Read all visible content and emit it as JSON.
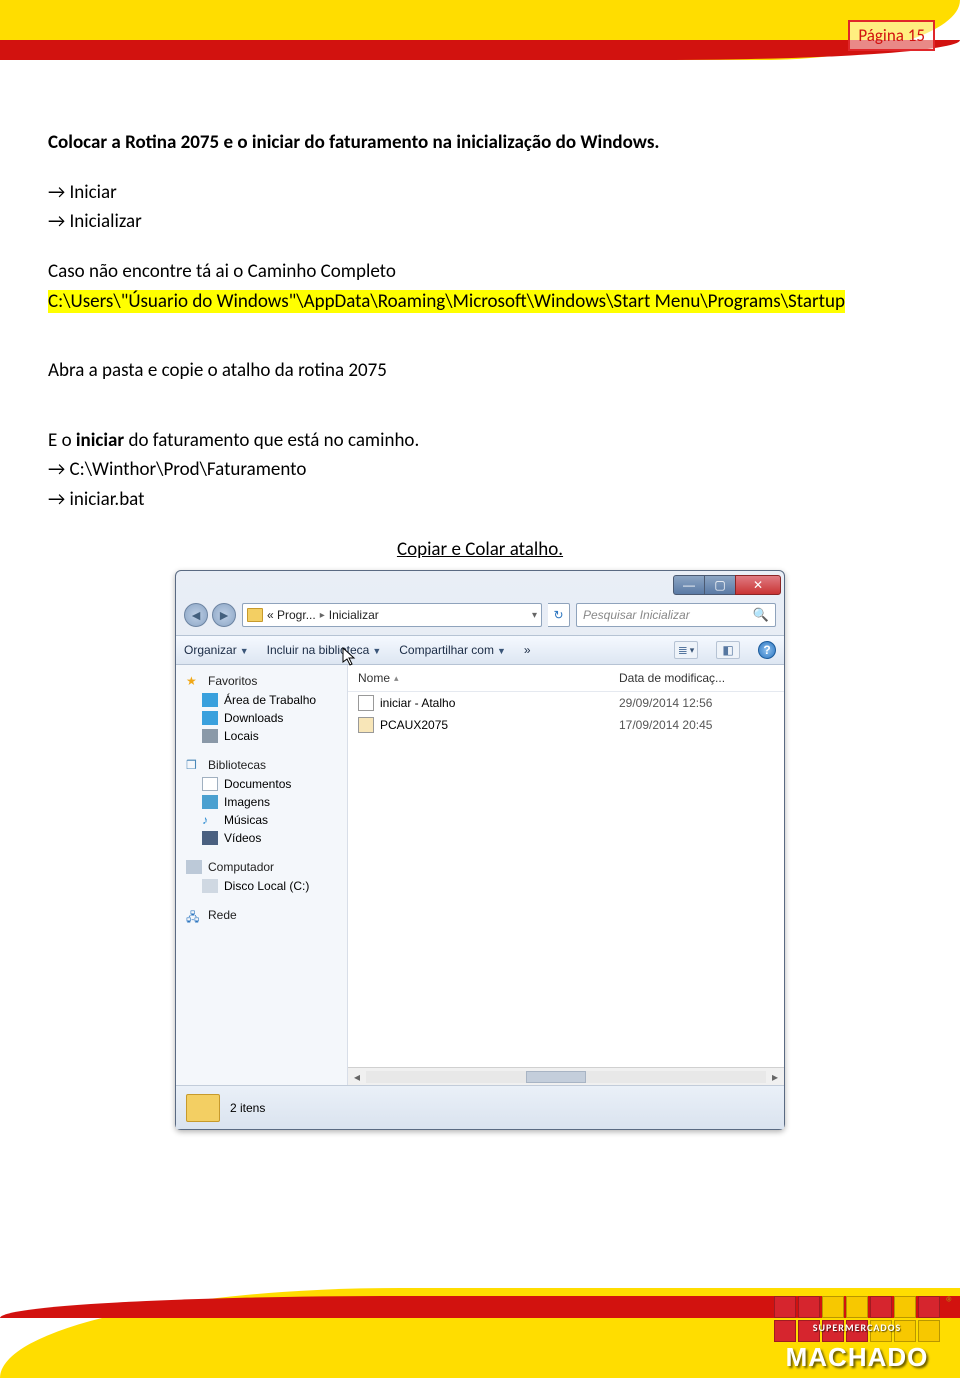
{
  "page_number": "Página 15",
  "doc": {
    "heading": "Colocar a Rotina 2075 e o iniciar do faturamento na inicialização do Windows.",
    "step1": "→ Iniciar",
    "step2": "→ Inicializar",
    "note": "Caso não encontre tá ai o Caminho Completo",
    "path_hl": "C:\\Users\\\"Úsuario do Windows\"\\AppData\\Roaming\\Microsoft\\Windows\\Start Menu\\Programs\\Startup",
    "open_folder": "Abra a pasta e copie o atalho da rotina 2075",
    "iniciar_line_prefix": "E o ",
    "iniciar_bold": "iniciar",
    "iniciar_line_suffix": " do faturamento que está no caminho.",
    "path2": "→ C:\\Winthor\\Prod\\Faturamento",
    "file": "→ iniciar.bat",
    "copy_paste": "Copiar e Colar atalho."
  },
  "explorer": {
    "breadcrumb": {
      "seg1": "« Progr...",
      "seg2": "Inicializar"
    },
    "search_placeholder": "Pesquisar Inicializar",
    "toolbar": {
      "organize": "Organizar",
      "include": "Incluir na biblioteca",
      "share": "Compartilhar com",
      "more": "»"
    },
    "sidebar": {
      "favorites": "Favoritos",
      "desktop": "Área de Trabalho",
      "downloads": "Downloads",
      "locations": "Locais",
      "libraries": "Bibliotecas",
      "documents": "Documentos",
      "images": "Imagens",
      "music": "Músicas",
      "videos": "Vídeos",
      "computer": "Computador",
      "disk": "Disco Local (C:)",
      "network": "Rede"
    },
    "columns": {
      "name": "Nome",
      "date": "Data de modificaç..."
    },
    "files": [
      {
        "name": "iniciar - Atalho",
        "date": "29/09/2014 12:56"
      },
      {
        "name": "PCAUX2075",
        "date": "17/09/2014 20:45"
      }
    ],
    "status": "2 itens"
  },
  "logo": {
    "super": "SUPERMERCADOS",
    "name": "MACHADO"
  }
}
